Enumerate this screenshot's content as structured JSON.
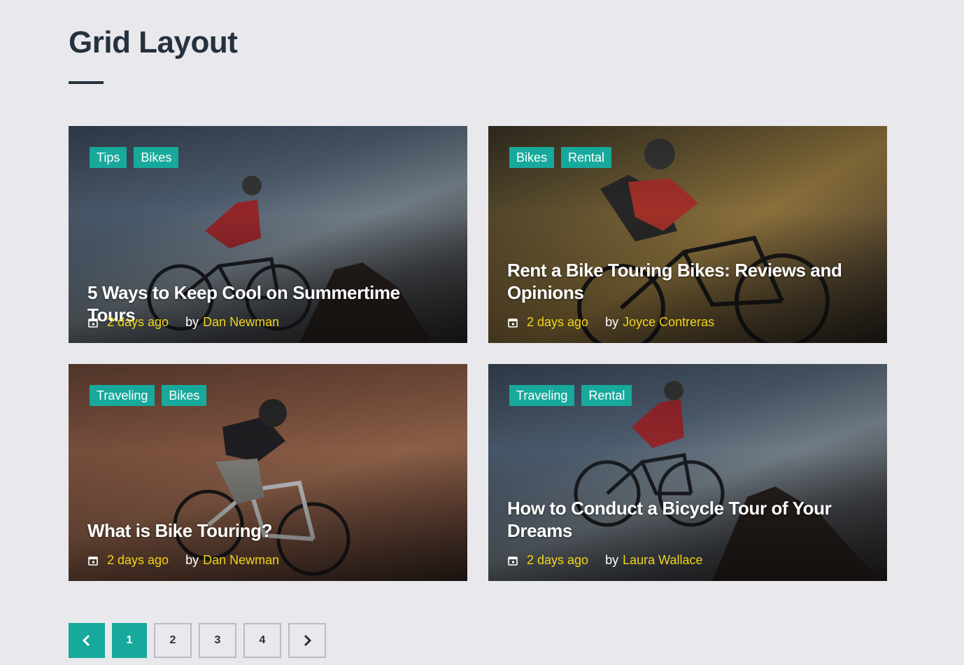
{
  "page": {
    "title": "Grid Layout"
  },
  "colors": {
    "accent": "#17a99b",
    "meta_link": "#f2d41a",
    "heading": "#25323d"
  },
  "cards": [
    {
      "tags": [
        "Tips",
        "Bikes"
      ],
      "title": "5 Ways to Keep Cool on Summertime Tours",
      "date": "2 days ago",
      "by": "by",
      "author": "Dan Newman"
    },
    {
      "tags": [
        "Bikes",
        "Rental"
      ],
      "title": "Rent a Bike Touring Bikes: Reviews and Opinions",
      "date": "2 days ago",
      "by": "by",
      "author": "Joyce Contreras"
    },
    {
      "tags": [
        "Traveling",
        "Bikes"
      ],
      "title": "What is Bike Touring?",
      "date": "2 days ago",
      "by": "by",
      "author": "Dan Newman"
    },
    {
      "tags": [
        "Traveling",
        "Rental"
      ],
      "title": "How to Conduct a Bicycle Tour of Your Dreams",
      "date": "2 days ago",
      "by": "by",
      "author": "Laura Wallace"
    }
  ],
  "pagination": {
    "prev_icon": "chevron-left-icon",
    "pages": [
      "1",
      "2",
      "3",
      "4"
    ],
    "current": "1",
    "next_icon": "chevron-right-icon"
  }
}
